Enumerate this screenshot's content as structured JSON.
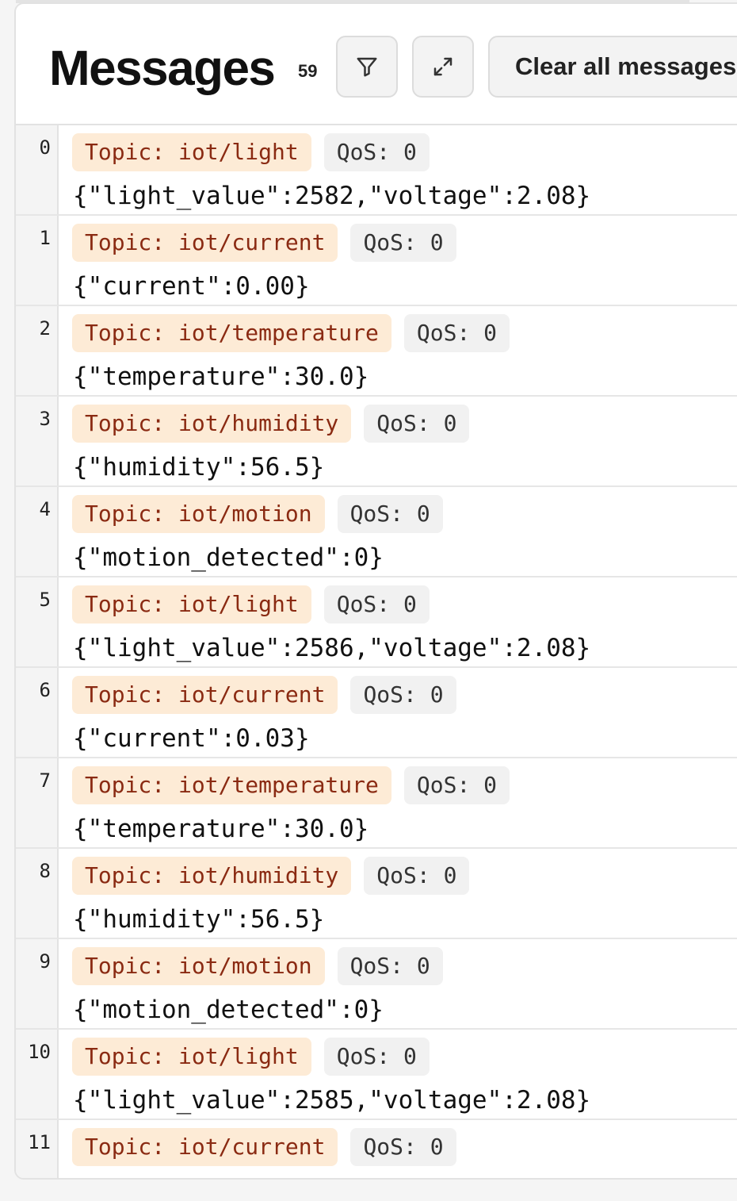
{
  "header": {
    "title": "Messages",
    "count": "59",
    "clear_label": "Clear all messages"
  },
  "icons": {
    "filter": "filter-icon",
    "expand": "expand-icon"
  },
  "messages": [
    {
      "index": "0",
      "topic": "Topic: iot/light",
      "qos": "QoS: 0",
      "payload": "{\"light_value\":2582,\"voltage\":2.08}"
    },
    {
      "index": "1",
      "topic": "Topic: iot/current",
      "qos": "QoS: 0",
      "payload": "{\"current\":0.00}"
    },
    {
      "index": "2",
      "topic": "Topic: iot/temperature",
      "qos": "QoS: 0",
      "payload": "{\"temperature\":30.0}"
    },
    {
      "index": "3",
      "topic": "Topic: iot/humidity",
      "qos": "QoS: 0",
      "payload": "{\"humidity\":56.5}"
    },
    {
      "index": "4",
      "topic": "Topic: iot/motion",
      "qos": "QoS: 0",
      "payload": "{\"motion_detected\":0}"
    },
    {
      "index": "5",
      "topic": "Topic: iot/light",
      "qos": "QoS: 0",
      "payload": "{\"light_value\":2586,\"voltage\":2.08}"
    },
    {
      "index": "6",
      "topic": "Topic: iot/current",
      "qos": "QoS: 0",
      "payload": "{\"current\":0.03}"
    },
    {
      "index": "7",
      "topic": "Topic: iot/temperature",
      "qos": "QoS: 0",
      "payload": "{\"temperature\":30.0}"
    },
    {
      "index": "8",
      "topic": "Topic: iot/humidity",
      "qos": "QoS: 0",
      "payload": "{\"humidity\":56.5}"
    },
    {
      "index": "9",
      "topic": "Topic: iot/motion",
      "qos": "QoS: 0",
      "payload": "{\"motion_detected\":0}"
    },
    {
      "index": "10",
      "topic": "Topic: iot/light",
      "qos": "QoS: 0",
      "payload": "{\"light_value\":2585,\"voltage\":2.08}"
    },
    {
      "index": "11",
      "topic": "Topic: iot/current",
      "qos": "QoS: 0",
      "payload": ""
    }
  ]
}
